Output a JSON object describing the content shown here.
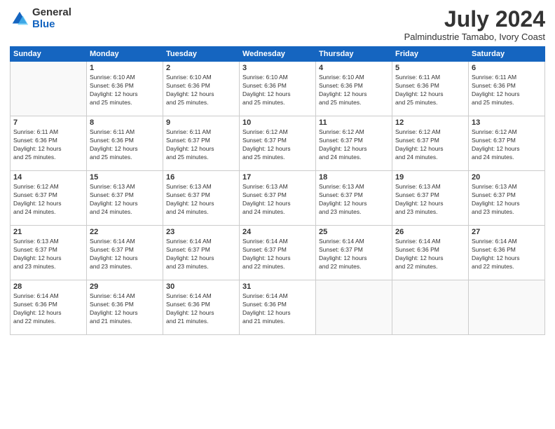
{
  "logo": {
    "general": "General",
    "blue": "Blue"
  },
  "title": "July 2024",
  "subtitle": "Palmindustrie Tamabo, Ivory Coast",
  "days_header": [
    "Sunday",
    "Monday",
    "Tuesday",
    "Wednesday",
    "Thursday",
    "Friday",
    "Saturday"
  ],
  "weeks": [
    [
      {
        "num": "",
        "info": ""
      },
      {
        "num": "1",
        "info": "Sunrise: 6:10 AM\nSunset: 6:36 PM\nDaylight: 12 hours\nand 25 minutes."
      },
      {
        "num": "2",
        "info": "Sunrise: 6:10 AM\nSunset: 6:36 PM\nDaylight: 12 hours\nand 25 minutes."
      },
      {
        "num": "3",
        "info": "Sunrise: 6:10 AM\nSunset: 6:36 PM\nDaylight: 12 hours\nand 25 minutes."
      },
      {
        "num": "4",
        "info": "Sunrise: 6:10 AM\nSunset: 6:36 PM\nDaylight: 12 hours\nand 25 minutes."
      },
      {
        "num": "5",
        "info": "Sunrise: 6:11 AM\nSunset: 6:36 PM\nDaylight: 12 hours\nand 25 minutes."
      },
      {
        "num": "6",
        "info": "Sunrise: 6:11 AM\nSunset: 6:36 PM\nDaylight: 12 hours\nand 25 minutes."
      }
    ],
    [
      {
        "num": "7",
        "info": "Sunrise: 6:11 AM\nSunset: 6:36 PM\nDaylight: 12 hours\nand 25 minutes."
      },
      {
        "num": "8",
        "info": "Sunrise: 6:11 AM\nSunset: 6:36 PM\nDaylight: 12 hours\nand 25 minutes."
      },
      {
        "num": "9",
        "info": "Sunrise: 6:11 AM\nSunset: 6:37 PM\nDaylight: 12 hours\nand 25 minutes."
      },
      {
        "num": "10",
        "info": "Sunrise: 6:12 AM\nSunset: 6:37 PM\nDaylight: 12 hours\nand 25 minutes."
      },
      {
        "num": "11",
        "info": "Sunrise: 6:12 AM\nSunset: 6:37 PM\nDaylight: 12 hours\nand 24 minutes."
      },
      {
        "num": "12",
        "info": "Sunrise: 6:12 AM\nSunset: 6:37 PM\nDaylight: 12 hours\nand 24 minutes."
      },
      {
        "num": "13",
        "info": "Sunrise: 6:12 AM\nSunset: 6:37 PM\nDaylight: 12 hours\nand 24 minutes."
      }
    ],
    [
      {
        "num": "14",
        "info": "Sunrise: 6:12 AM\nSunset: 6:37 PM\nDaylight: 12 hours\nand 24 minutes."
      },
      {
        "num": "15",
        "info": "Sunrise: 6:13 AM\nSunset: 6:37 PM\nDaylight: 12 hours\nand 24 minutes."
      },
      {
        "num": "16",
        "info": "Sunrise: 6:13 AM\nSunset: 6:37 PM\nDaylight: 12 hours\nand 24 minutes."
      },
      {
        "num": "17",
        "info": "Sunrise: 6:13 AM\nSunset: 6:37 PM\nDaylight: 12 hours\nand 24 minutes."
      },
      {
        "num": "18",
        "info": "Sunrise: 6:13 AM\nSunset: 6:37 PM\nDaylight: 12 hours\nand 23 minutes."
      },
      {
        "num": "19",
        "info": "Sunrise: 6:13 AM\nSunset: 6:37 PM\nDaylight: 12 hours\nand 23 minutes."
      },
      {
        "num": "20",
        "info": "Sunrise: 6:13 AM\nSunset: 6:37 PM\nDaylight: 12 hours\nand 23 minutes."
      }
    ],
    [
      {
        "num": "21",
        "info": "Sunrise: 6:13 AM\nSunset: 6:37 PM\nDaylight: 12 hours\nand 23 minutes."
      },
      {
        "num": "22",
        "info": "Sunrise: 6:14 AM\nSunset: 6:37 PM\nDaylight: 12 hours\nand 23 minutes."
      },
      {
        "num": "23",
        "info": "Sunrise: 6:14 AM\nSunset: 6:37 PM\nDaylight: 12 hours\nand 23 minutes."
      },
      {
        "num": "24",
        "info": "Sunrise: 6:14 AM\nSunset: 6:37 PM\nDaylight: 12 hours\nand 22 minutes."
      },
      {
        "num": "25",
        "info": "Sunrise: 6:14 AM\nSunset: 6:37 PM\nDaylight: 12 hours\nand 22 minutes."
      },
      {
        "num": "26",
        "info": "Sunrise: 6:14 AM\nSunset: 6:36 PM\nDaylight: 12 hours\nand 22 minutes."
      },
      {
        "num": "27",
        "info": "Sunrise: 6:14 AM\nSunset: 6:36 PM\nDaylight: 12 hours\nand 22 minutes."
      }
    ],
    [
      {
        "num": "28",
        "info": "Sunrise: 6:14 AM\nSunset: 6:36 PM\nDaylight: 12 hours\nand 22 minutes."
      },
      {
        "num": "29",
        "info": "Sunrise: 6:14 AM\nSunset: 6:36 PM\nDaylight: 12 hours\nand 21 minutes."
      },
      {
        "num": "30",
        "info": "Sunrise: 6:14 AM\nSunset: 6:36 PM\nDaylight: 12 hours\nand 21 minutes."
      },
      {
        "num": "31",
        "info": "Sunrise: 6:14 AM\nSunset: 6:36 PM\nDaylight: 12 hours\nand 21 minutes."
      },
      {
        "num": "",
        "info": ""
      },
      {
        "num": "",
        "info": ""
      },
      {
        "num": "",
        "info": ""
      }
    ]
  ]
}
